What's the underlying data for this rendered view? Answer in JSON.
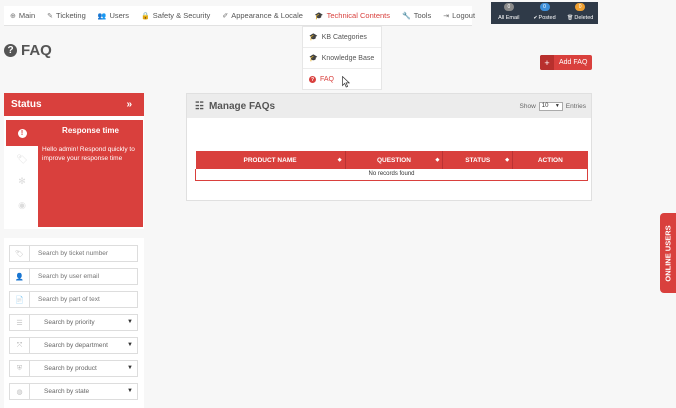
{
  "nav": {
    "items": [
      {
        "label": "Main",
        "icon": "⊕",
        "name": "nav-main"
      },
      {
        "label": "Ticketing",
        "icon": "✎",
        "name": "nav-ticketing"
      },
      {
        "label": "Users",
        "icon": "👥",
        "name": "nav-users"
      },
      {
        "label": "Safety & Security",
        "icon": "🔒",
        "name": "nav-safety-security"
      },
      {
        "label": "Appearance & Locale",
        "icon": "✐",
        "name": "nav-appearance-locale"
      },
      {
        "label": "Technical Contents",
        "icon": "🎓",
        "name": "nav-technical-contents"
      },
      {
        "label": "Tools",
        "icon": "🔧",
        "name": "nav-tools"
      },
      {
        "label": "Logout",
        "icon": "⇥",
        "name": "nav-logout"
      }
    ]
  },
  "counters": [
    {
      "label": "All Email",
      "count": "0",
      "color": "#8a8a8a",
      "icon": ""
    },
    {
      "label": "Posted",
      "count": "0",
      "color": "#3d8fd9",
      "icon": "✔"
    },
    {
      "label": "Deleted",
      "count": "0",
      "color": "#f0a030",
      "icon": "🗑"
    }
  ],
  "dropdown": {
    "items": [
      {
        "label": "KB Categories",
        "icon": "🎓"
      },
      {
        "label": "Knowledge Base",
        "icon": "🎓"
      },
      {
        "label": "FAQ",
        "icon": "?"
      }
    ]
  },
  "page": {
    "title": "FAQ",
    "add_label": "Add FAQ"
  },
  "status": {
    "title": "Status",
    "response_title": "Response time",
    "response_message": "Hello admin! Respond quickly to improve your response time"
  },
  "filters": {
    "ticket_number_placeholder": "Search by ticket number",
    "user_email_placeholder": "Search by user email",
    "text_placeholder": "Search by part of text",
    "priority": "Search by priority",
    "department": "Search by department",
    "product": "Search by product",
    "state": "Search by state"
  },
  "manage": {
    "title": "Manage FAQs",
    "show_label": "Show",
    "show_value": "10",
    "entries_label": "Entries",
    "columns": [
      "PRODUCT NAME",
      "QUESTION",
      "STATUS",
      "ACTION"
    ],
    "empty_message": "No records found"
  },
  "online_users_label": "ONLINE USERS",
  "colors": {
    "accent": "#d9403d",
    "header_dark": "#2f3a48"
  }
}
